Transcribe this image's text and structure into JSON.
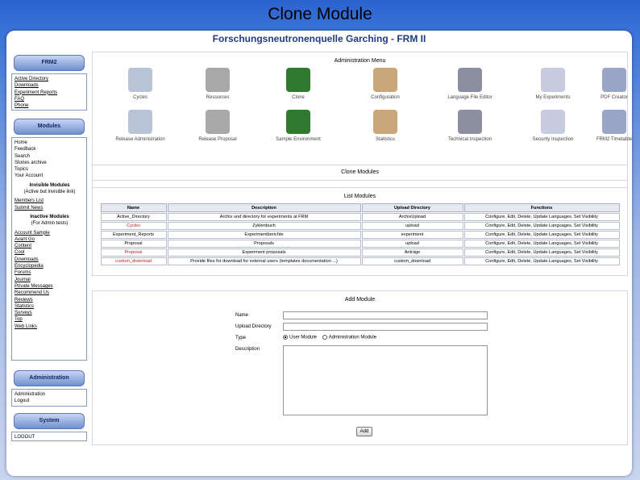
{
  "slide_title": "Clone Module",
  "site_title": "Forschungsneutronenquelle Garching - FRM II",
  "sidebar": {
    "frm2_head": "FRM2",
    "frm2_items": [
      "Active Directory",
      "Downloads",
      "Experiment Reports",
      "FAQ",
      "Phone"
    ],
    "modules_head": "Modules",
    "modules_items": [
      "Home",
      "Feedback",
      "Search",
      "Stories archive",
      "Topics",
      "Your Account"
    ],
    "invisible_title": "Invisible Modules",
    "invisible_sub": "(Active but invisible link)",
    "invisible_items": [
      "Members List",
      "Submit News"
    ],
    "inactive_title": "Inactive Modules",
    "inactive_sub": "(For Admin tests)",
    "inactive_items": [
      "Account Sample",
      "Avant Go",
      "Content",
      "Cool",
      "Downloads",
      "Encyclopedia",
      "Forums",
      "Journal",
      "Private Messages",
      "Recommend Us",
      "Reviews",
      "Statistics",
      "Surveys",
      "Top",
      "Web Links"
    ],
    "admin_head": "Administration",
    "admin_items": [
      "Administration",
      "Logout"
    ],
    "system_head": "System",
    "system_items": [
      "LOGOUT"
    ]
  },
  "admin_menu": {
    "title": "Administration Menu",
    "row1": [
      "Cycles",
      "Resources",
      "Clone",
      "Configuration",
      "Language File Editor",
      "My Experiments",
      "PDF Creator"
    ],
    "row2": [
      "Release Administration",
      "Release Proposal",
      "Sample Environment",
      "Statistics",
      "Technical Inspection",
      "Security Inspection",
      "FRM2 Timetable"
    ]
  },
  "clone_panel": {
    "title": "Clone Modules"
  },
  "list_panel": {
    "title": "List Modules",
    "headers": [
      "Name",
      "Description",
      "Upload Directory",
      "Functions"
    ],
    "rows": [
      {
        "name": "Active_Directory",
        "desc": "Archiv und directory for experiments at FRM",
        "dir": "ArchivUpload",
        "fn": "Configure, Edit, Delete, Update Languages, Set Visibility"
      },
      {
        "name": "Cycles",
        "desc": "Zyklenbuch",
        "dir": "upload",
        "fn": "Configure, Edit, Delete, Update Languages, Set Visibility"
      },
      {
        "name": "Experiment_Reports",
        "desc": "Experimentberichte",
        "dir": "experiment",
        "fn": "Configure, Edit, Delete, Update Languages, Set Visibility"
      },
      {
        "name": "Proposal",
        "desc": "Proposals",
        "dir": "upload",
        "fn": "Configure, Edit, Delete, Update Languages, Set Visibility"
      },
      {
        "name": "Proposal",
        "desc": "Experiment proposals",
        "dir": "Anträge",
        "fn": "Configure, Edit, Delete, Update Languages, Set Visibility"
      },
      {
        "name": "custom_download",
        "desc": "Provide files for download for external users (templates documentation ...)",
        "dir": "custom_download",
        "fn": "Configure, Edit, Delete, Update Languages, Set Visibility"
      }
    ],
    "red_rows": [
      1,
      4,
      5
    ]
  },
  "add_panel": {
    "title": "Add Module",
    "name_label": "Name",
    "dir_label": "Upload Directory",
    "type_label": "Type",
    "desc_label": "Description",
    "opt_user": "User Module",
    "opt_admin": "Administration Module",
    "add_btn": "Add"
  },
  "colors": {
    "accent": "#1f3c80",
    "link_red": "#c21b1b"
  }
}
